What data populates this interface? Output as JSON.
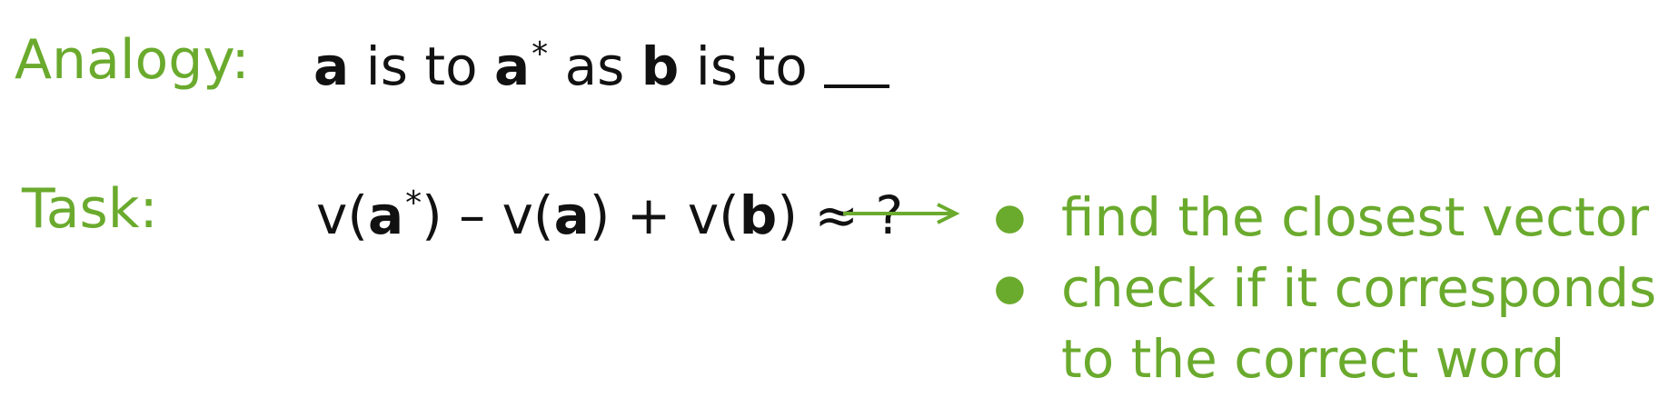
{
  "colors": {
    "accent": "#6aaa2d",
    "text": "#111111"
  },
  "analogy": {
    "label": "Analogy:",
    "a": "a",
    "is_to_1": " is to ",
    "a_star": "a",
    "star": "*",
    "as": " as ",
    "b": "b",
    "is_to_2": " is to "
  },
  "task": {
    "label": "Task:",
    "v1": "v(",
    "a_star": "a",
    "star": "*",
    "close1": ")",
    "minus": " – v(",
    "a": "a",
    "close2": ")",
    "plus": " + v(",
    "b": "b",
    "close3": ")",
    "approx": " ≈ ?"
  },
  "steps": [
    {
      "text": "find the closest vector"
    },
    {
      "text": "check if it corresponds",
      "continuation": "to the correct word"
    }
  ]
}
